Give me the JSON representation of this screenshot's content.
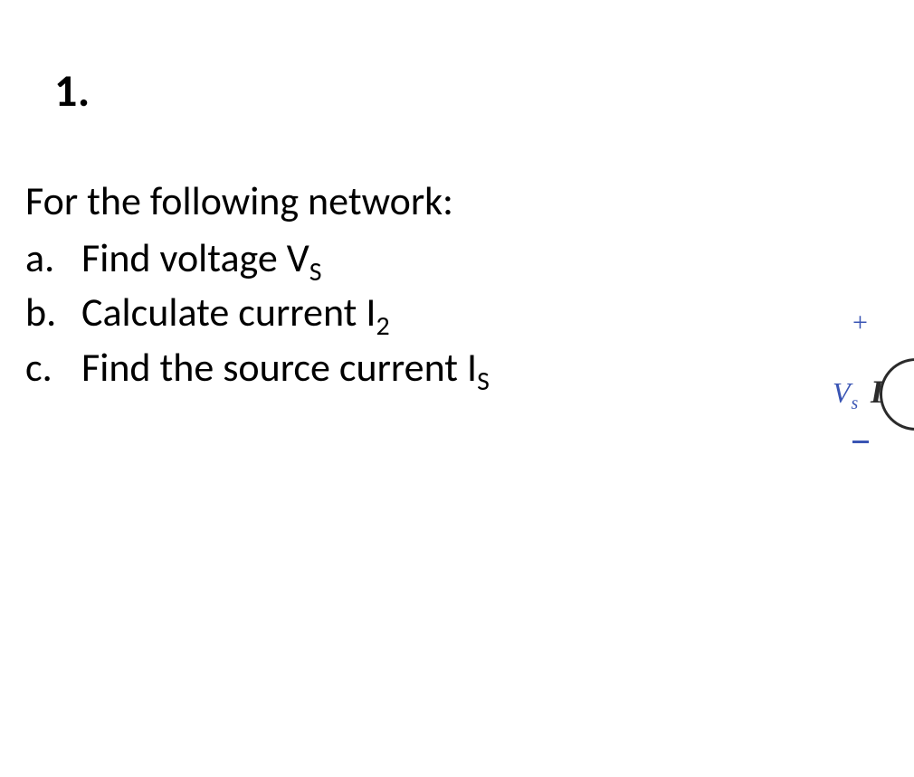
{
  "problem": {
    "number": "1.",
    "prompt": "For the following network:",
    "items": [
      {
        "marker": "a.",
        "text_html": "Find voltage V<span class=\"sub\">S</span>"
      },
      {
        "marker": "b.",
        "text_html": "Calculate current I<span class=\"sub\">2</span>"
      },
      {
        "marker": "c.",
        "text_html": "Find the source current I<span class=\"sub\">S</span>"
      }
    ]
  },
  "diagram": {
    "plus": "+",
    "vs_html": "V<span class=\"vs-sub\">s</span>",
    "i_label": "I"
  }
}
